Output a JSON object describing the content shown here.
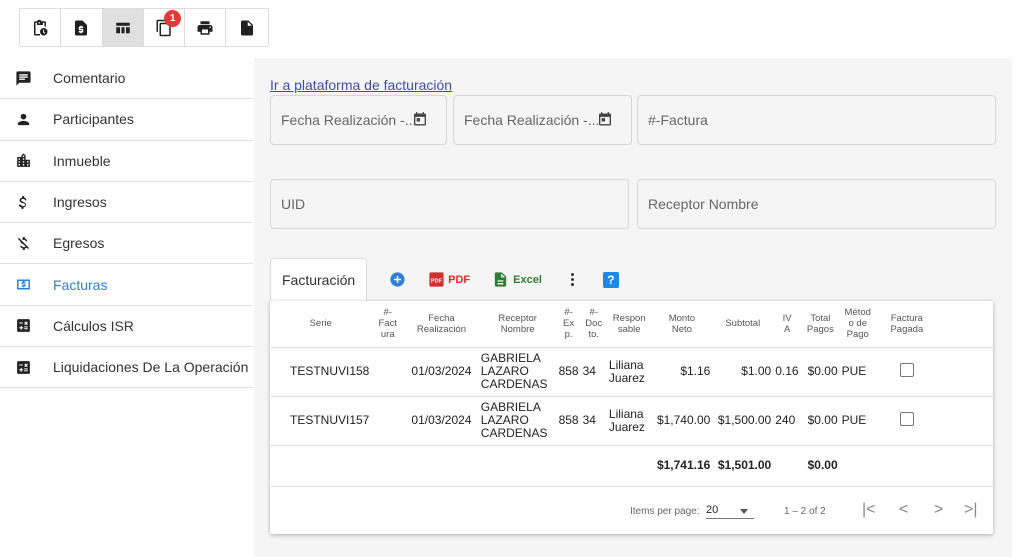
{
  "toolbar": {
    "icons": [
      "clipboard-clock-icon",
      "invoice-dollar-icon",
      "table-icon",
      "copy-icon",
      "print-icon",
      "document-icon"
    ],
    "badge_count": "1"
  },
  "sidebar": {
    "items": [
      {
        "label": "Comentario",
        "icon": "comment-icon"
      },
      {
        "label": "Participantes",
        "icon": "person-icon"
      },
      {
        "label": "Inmueble",
        "icon": "building-icon"
      },
      {
        "label": "Ingresos",
        "icon": "dollar-icon"
      },
      {
        "label": "Egresos",
        "icon": "money-off-icon"
      },
      {
        "label": "Facturas",
        "icon": "bill-icon"
      },
      {
        "label": "Cálculos ISR",
        "icon": "calculator-icon"
      },
      {
        "label": "Liquidaciones De La Operación",
        "icon": "calculator-icon"
      }
    ],
    "active_color": "#2f7fd3"
  },
  "main": {
    "link": "Ir a plataforma de facturación",
    "fields": {
      "fecha1": "Fecha Realización -...",
      "fecha2": "Fecha Realización -...",
      "factura": "#-Factura",
      "uid": "UID",
      "receptor": "Receptor Nombre"
    },
    "tab": "Facturación",
    "tools": {
      "pdf": "PDF",
      "excel": "Excel",
      "help": "?"
    },
    "table": {
      "headers": [
        "Serie",
        "#-\nFact\nura",
        "Fecha\nRealización",
        "Receptor\nNombre",
        "#-\nEx\np.",
        "#-\nDoc\nto.",
        "Respon\nsable",
        "Monto\nNeto",
        "Subtotal",
        "IV\nA",
        "Total\nPagos",
        "Métod\no de\nPago",
        "Factura\nPagada"
      ],
      "rows": [
        {
          "serie": "TESTNUVI158",
          "fecha": "01/03/2024",
          "receptor": [
            "GABRIELA",
            "LAZARO",
            "CARDENAS"
          ],
          "exp": "858",
          "docto": "34",
          "responsable": [
            "Liliana",
            "Juarez"
          ],
          "monto": "$1.16",
          "subtotal": "$1.00",
          "iva": "0.16",
          "total": "$0.00",
          "metodo": "PUE"
        },
        {
          "serie": "TESTNUVI157",
          "fecha": "01/03/2024",
          "receptor": [
            "GABRIELA",
            "LAZARO",
            "CARDENAS"
          ],
          "exp": "858",
          "docto": "34",
          "responsable": [
            "Liliana",
            "Juarez"
          ],
          "monto": "$1,740.00",
          "subtotal": "$1,500.00",
          "iva": "240",
          "total": "$0.00",
          "metodo": "PUE"
        }
      ],
      "totals": {
        "monto": "$1,741.16",
        "subtotal": "$1,501.00",
        "total": "$0.00"
      }
    },
    "pager": {
      "items_label": "Items per page:",
      "page_size": "20",
      "range": "1 – 2 of 2"
    }
  }
}
